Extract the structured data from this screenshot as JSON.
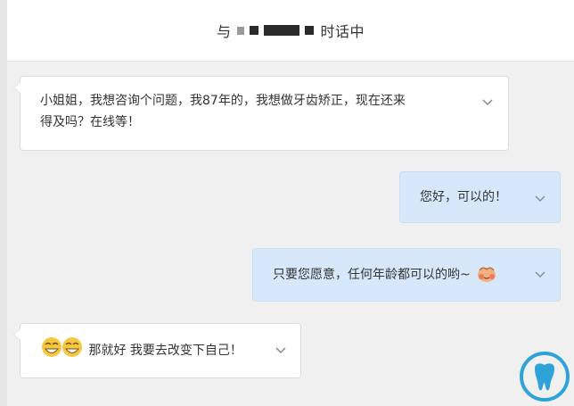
{
  "header": {
    "title_prefix": "与",
    "title_suffix": "时话中"
  },
  "messages": [
    {
      "side": "in",
      "text_line1": "小姐姐，我想咨询个问题，我87年的，我想做牙齿矫正，现在还来",
      "text_line2": "得及吗？在线等！"
    },
    {
      "side": "out",
      "text": "您好，可以的！"
    },
    {
      "side": "out",
      "text": "只要您愿意，任何年龄都可以的哟~"
    },
    {
      "side": "in",
      "text": "那就好 我要去改变下自己！"
    }
  ],
  "icons": {
    "dropdown": "chevron-down-icon",
    "emoji_blush": "blushing-face-icon",
    "emoji_laugh": "laughing-faces-icon",
    "watermark": "tooth-logo-icon"
  },
  "colors": {
    "incoming_bubble": "#ffffff",
    "outgoing_bubble": "#d7e8fb",
    "chevron": "#8a8a8a",
    "logo": "#2ea3d8"
  }
}
